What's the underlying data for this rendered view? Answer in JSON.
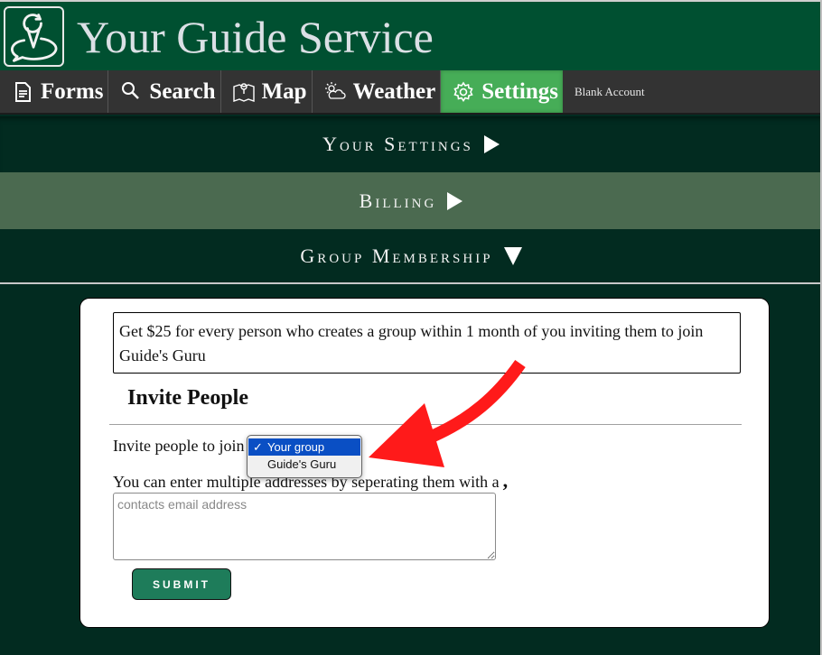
{
  "header": {
    "app_title": "Your Guide Service",
    "logo_icon": "map-pin-chat-icon"
  },
  "nav": {
    "items": [
      {
        "label": "Forms",
        "icon": "document-icon"
      },
      {
        "label": "Search",
        "icon": "search-icon"
      },
      {
        "label": "Map",
        "icon": "map-icon"
      },
      {
        "label": "Weather",
        "icon": "weather-icon"
      },
      {
        "label": "Settings",
        "icon": "gear-icon",
        "active": true
      }
    ],
    "account_label": "Blank Account"
  },
  "accordion": {
    "your_settings": "Your Settings",
    "billing": "Billing",
    "group_membership": "Group Membership"
  },
  "group_membership": {
    "promo_text": "Get $25 for every person who creates a group within 1 month of you inviting them to join Guide's Guru",
    "section_title": "Invite People",
    "invite_label": "Invite people to join",
    "group_select": {
      "selected": "Your group",
      "options": [
        "Your group",
        "Guide's Guru"
      ]
    },
    "multi_label": "You can enter multiple addresses by seperating them with a",
    "multi_separator": ",",
    "email_placeholder": "contacts email address",
    "email_value": "",
    "submit_label": "SUBMIT"
  },
  "colors": {
    "header_bg": "#005031",
    "nav_bg": "#333333",
    "nav_active": "#46ad57",
    "page_bg": "#022b20",
    "billing_bg": "#4b6a50",
    "submit_bg": "#1e7c5a",
    "select_highlight": "#0a4fc4",
    "annotation_arrow": "#ff1a1a"
  }
}
